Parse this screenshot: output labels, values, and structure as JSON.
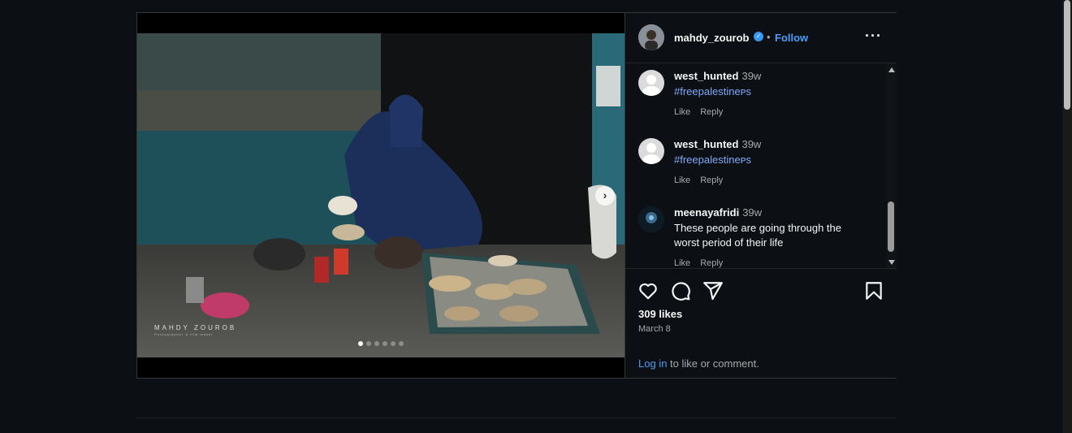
{
  "post": {
    "author": {
      "username": "mahdy_zourob",
      "verified": true,
      "follow_label": "Follow",
      "separator": "•"
    },
    "more_icon": "more-horizontal-icon",
    "media": {
      "watermark_title": "MAHDY ZOUROB",
      "watermark_subtitle": "Photographer & film maker",
      "next_icon": "chevron-right-icon",
      "carousel_total": 6,
      "carousel_active": 0
    },
    "comments": [
      {
        "username": "west_hunted",
        "time": "39w",
        "text": "#freepalestineᴘs",
        "is_tag": true,
        "like_label": "Like",
        "reply_label": "Reply"
      },
      {
        "username": "west_hunted",
        "time": "39w",
        "text": "#freepalestineᴘs",
        "is_tag": true,
        "like_label": "Like",
        "reply_label": "Reply"
      },
      {
        "username": "meenayafridi",
        "time": "39w",
        "text": "These people are going through the worst period of their life",
        "is_tag": false,
        "like_label": "Like",
        "reply_label": "Reply"
      }
    ],
    "action_icons": [
      "heart-icon",
      "comment-icon",
      "share-icon",
      "bookmark-icon"
    ],
    "likes": "309 likes",
    "date": "March 8",
    "login_link": "Log in",
    "login_rest": " to like or comment.",
    "colors": {
      "accent": "#4a9ef8",
      "background": "#0c1014",
      "hashtag": "#7fa8f7"
    }
  }
}
